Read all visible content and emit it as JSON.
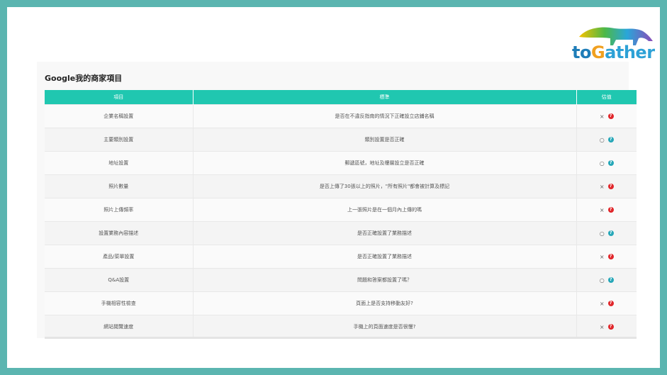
{
  "logo": {
    "text_to": "to",
    "text_g": "G",
    "text_ather": "ather"
  },
  "title": "Google我的商家項目",
  "headers": {
    "item": "項目",
    "standard": "標準",
    "evaluation": "估值"
  },
  "rows": [
    {
      "item": "企業名稱設置",
      "standard": "是否在不違反指南的情況下正確設立店鋪名稱",
      "mark": "×",
      "status": "error"
    },
    {
      "item": "主要類別設置",
      "standard": "類別設置是否正確",
      "mark": "○",
      "status": "ok"
    },
    {
      "item": "地址設置",
      "standard": "郵遞區號，地址及樓層設立是否正確",
      "mark": "○",
      "status": "ok"
    },
    {
      "item": "照片數量",
      "standard": "是否上傳了30張以上的照片，\"所有照片\"都會被計算及標記",
      "mark": "×",
      "status": "error"
    },
    {
      "item": "照片上傳頻率",
      "standard": "上一張照片是在一個月內上傳的嗎",
      "mark": "×",
      "status": "error"
    },
    {
      "item": "設置業務內容描述",
      "standard": "是否正確設置了業務描述",
      "mark": "○",
      "status": "ok"
    },
    {
      "item": "產品/菜單設置",
      "standard": "是否正確設置了業務描述",
      "mark": "×",
      "status": "error"
    },
    {
      "item": "Q&A設置",
      "standard": "問題和答案都設置了嗎？",
      "mark": "○",
      "status": "ok"
    },
    {
      "item": "手機相容性檢查",
      "standard": "頁面上是否支持移動友好?",
      "mark": "×",
      "status": "error"
    },
    {
      "item": "網站閱覽速度",
      "standard": "手機上的頁面速度是否很慢?",
      "mark": "×",
      "status": "error"
    }
  ],
  "colors": {
    "header": "#20c7b0",
    "error": "#e0262a",
    "ok": "#26a7b8",
    "frame": "#5bb5b0"
  }
}
